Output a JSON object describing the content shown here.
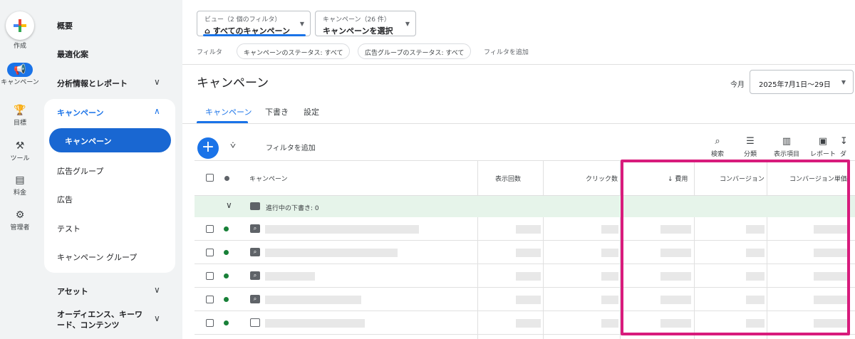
{
  "rail": {
    "create": "作成",
    "items": [
      {
        "label": "キャンペーン",
        "icon": "megaphone-icon"
      },
      {
        "label": "目標",
        "icon": "trophy-icon"
      },
      {
        "label": "ツール",
        "icon": "tools-icon"
      },
      {
        "label": "料金",
        "icon": "billing-icon"
      },
      {
        "label": "管理者",
        "icon": "gear-icon"
      }
    ]
  },
  "nav": {
    "top": [
      "概要",
      "最適化案",
      "分析情報とレポート"
    ],
    "group_title": "キャンペーン",
    "group_items": [
      "キャンペーン",
      "広告グループ",
      "広告",
      "テスト",
      "キャンペーン グループ"
    ],
    "bottom": [
      "アセット",
      "オーディエンス、キーワード、コンテンツ"
    ]
  },
  "filters": {
    "view_caption": "ビュー（2 個のフィルタ）",
    "view_value": "すべてのキャンペーン",
    "campaign_caption": "キャンペーン（26 件）",
    "campaign_value": "キャンペーンを選択",
    "filter_label": "フィルタ",
    "chips": [
      "キャンペーンのステータス: すべて",
      "広告グループのステータス: すべて"
    ],
    "add_filter": "フィルタを追加"
  },
  "page": {
    "title": "キャンペーン",
    "period_label": "今月",
    "date_range": "2025年7月1日〜29日"
  },
  "tabs": [
    "キャンペーン",
    "下書き",
    "設定"
  ],
  "toolbar": {
    "add_filter": "フィルタを追加",
    "tools": [
      "検索",
      "分類",
      "表示項目",
      "レポート",
      "ダ"
    ]
  },
  "table": {
    "headers": [
      "キャンペーン",
      "表示回数",
      "クリック数",
      "費用",
      "コンバージョン",
      "コンバージョン単価"
    ],
    "draft_row": "進行中の下書き: 0",
    "row_icons": [
      "search-icon",
      "search-icon",
      "search-icon",
      "search-icon",
      "display-icon"
    ]
  },
  "colors": {
    "accent": "#1a73e8",
    "highlight": "#d81b7c",
    "status_enabled": "#188038",
    "draft_row_bg": "#e6f4ea"
  }
}
